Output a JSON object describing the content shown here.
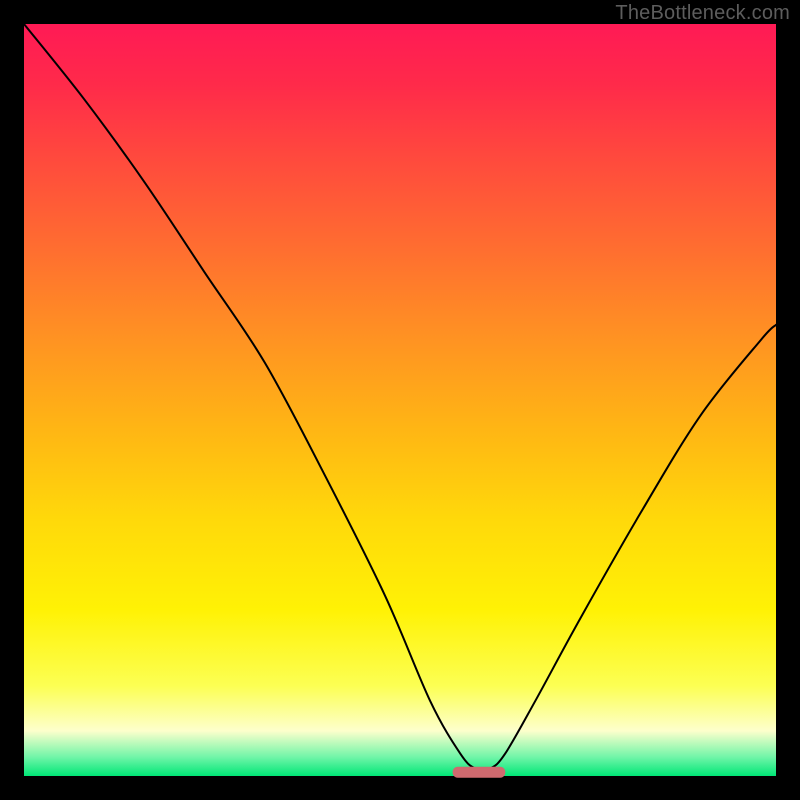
{
  "watermark": "TheBottleneck.com",
  "chart_data": {
    "type": "line",
    "title": "",
    "xlabel": "",
    "ylabel": "",
    "xlim": [
      0,
      100
    ],
    "ylim": [
      0,
      100
    ],
    "grid": false,
    "legend": false,
    "series": [
      {
        "name": "bottleneck-curve",
        "x": [
          0,
          8,
          16,
          24,
          32,
          40,
          48,
          54,
          58,
          60,
          62,
          64,
          68,
          74,
          82,
          90,
          98,
          100
        ],
        "y": [
          100,
          90,
          79,
          67,
          55,
          40,
          24,
          10,
          3,
          1,
          1,
          3,
          10,
          21,
          35,
          48,
          58,
          60
        ],
        "stroke": "#000000",
        "width": 2
      }
    ],
    "marker": {
      "name": "optimal-range-pill",
      "x_center": 60.5,
      "y": 0.5,
      "width_pct": 7,
      "fill": "#cf6a6f"
    }
  }
}
